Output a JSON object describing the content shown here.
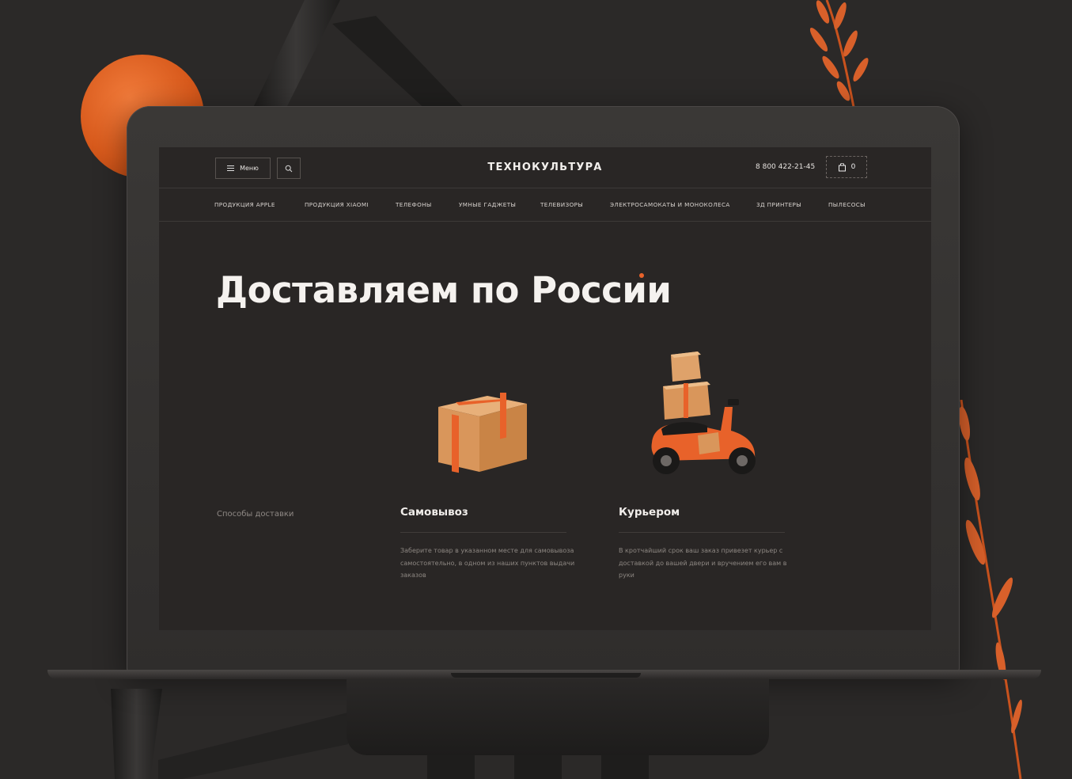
{
  "header": {
    "menu_label": "Меню",
    "logo": "ТЕХНОКУЛЬТУРА",
    "phone": "8 800 422-21-45",
    "cart_count": "0"
  },
  "nav": {
    "items": [
      "ПРОДУКЦИЯ APPLE",
      "ПРОДУКЦИЯ XIAOMI",
      "ТЕЛЕФОНЫ",
      "УМНЫЕ ГАДЖЕТЫ",
      "ТЕЛЕВИЗОРЫ",
      "ЭЛЕКТРОСАМОКАТЫ И МОНОКОЛЕСА",
      "3Д ПРИНТЕРЫ",
      "ПЫЛЕСОСЫ"
    ]
  },
  "hero": {
    "title": "Доставляем по России"
  },
  "delivery": {
    "section_label": "Способы доставки",
    "pickup": {
      "title": "Самовывоз",
      "description": "Заберите товар в указанном месте для самовывоза самостоятельно, в одном из наших пунктов выдачи заказов"
    },
    "courier": {
      "title": "Курьером",
      "description": "В кротчайший срок ваш заказ привезет курьер с доставкой до вашей двери и вручением его вам в руки"
    }
  },
  "colors": {
    "accent": "#e8622a",
    "background": "#2b2928",
    "screen": "#292625"
  }
}
